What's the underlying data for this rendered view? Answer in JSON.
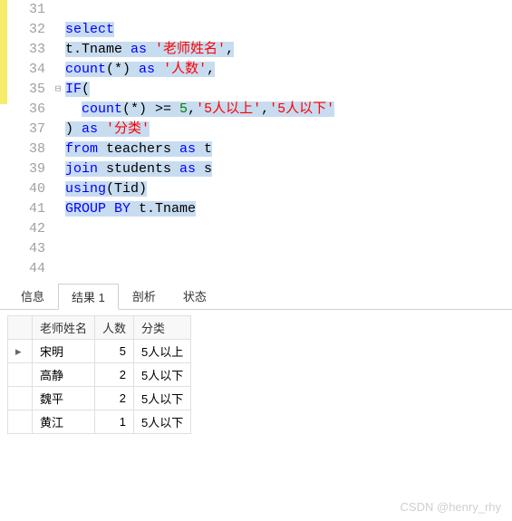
{
  "editor": {
    "lines": [
      {
        "num": "31",
        "fold": "",
        "tokens": []
      },
      {
        "num": "32",
        "fold": "",
        "tokens": [
          {
            "t": "select",
            "c": "kw-blue",
            "s": true
          }
        ]
      },
      {
        "num": "33",
        "fold": "",
        "tokens": [
          {
            "t": "t.Tname ",
            "c": "plain",
            "s": true
          },
          {
            "t": "as",
            "c": "kw-blue",
            "s": true
          },
          {
            "t": " ",
            "c": "plain",
            "s": true
          },
          {
            "t": "'老师姓名'",
            "c": "str-red",
            "s": true
          },
          {
            "t": ",",
            "c": "plain",
            "s": true
          }
        ]
      },
      {
        "num": "34",
        "fold": "",
        "tokens": [
          {
            "t": "count",
            "c": "kw-blue",
            "s": true
          },
          {
            "t": "(*) ",
            "c": "plain",
            "s": true
          },
          {
            "t": "as",
            "c": "kw-blue",
            "s": true
          },
          {
            "t": " ",
            "c": "plain",
            "s": true
          },
          {
            "t": "'人数'",
            "c": "str-red",
            "s": true
          },
          {
            "t": ",",
            "c": "plain",
            "s": true
          }
        ]
      },
      {
        "num": "35",
        "fold": "⊟",
        "tokens": [
          {
            "t": "IF",
            "c": "kw-blue",
            "s": true
          },
          {
            "t": "(",
            "c": "plain",
            "s": true
          }
        ]
      },
      {
        "num": "36",
        "fold": "",
        "tokens": [
          {
            "t": "  ",
            "c": "plain",
            "s": false
          },
          {
            "t": "count",
            "c": "kw-blue",
            "s": true
          },
          {
            "t": "(*) >= ",
            "c": "plain",
            "s": true
          },
          {
            "t": "5",
            "c": "num-green",
            "s": true
          },
          {
            "t": ",",
            "c": "plain",
            "s": true
          },
          {
            "t": "'5人以上'",
            "c": "str-red",
            "s": true
          },
          {
            "t": ",",
            "c": "plain",
            "s": true
          },
          {
            "t": "'5人以下'",
            "c": "str-red",
            "s": true
          }
        ]
      },
      {
        "num": "37",
        "fold": "",
        "tokens": [
          {
            "t": ") ",
            "c": "plain",
            "s": true
          },
          {
            "t": "as",
            "c": "kw-blue",
            "s": true
          },
          {
            "t": " ",
            "c": "plain",
            "s": true
          },
          {
            "t": "'分类'",
            "c": "str-red",
            "s": true
          }
        ]
      },
      {
        "num": "38",
        "fold": "",
        "tokens": [
          {
            "t": "from",
            "c": "kw-blue",
            "s": true
          },
          {
            "t": " teachers ",
            "c": "plain",
            "s": true
          },
          {
            "t": "as",
            "c": "kw-blue",
            "s": true
          },
          {
            "t": " t",
            "c": "plain",
            "s": true
          }
        ]
      },
      {
        "num": "39",
        "fold": "",
        "tokens": [
          {
            "t": "join",
            "c": "kw-blue",
            "s": true
          },
          {
            "t": " students ",
            "c": "plain",
            "s": true
          },
          {
            "t": "as",
            "c": "kw-blue",
            "s": true
          },
          {
            "t": " s",
            "c": "plain",
            "s": true
          }
        ]
      },
      {
        "num": "40",
        "fold": "",
        "tokens": [
          {
            "t": "using",
            "c": "kw-blue",
            "s": true
          },
          {
            "t": "(Tid)",
            "c": "plain",
            "s": true
          }
        ]
      },
      {
        "num": "41",
        "fold": "",
        "tokens": [
          {
            "t": "GROUP BY",
            "c": "kw-blue",
            "s": true
          },
          {
            "t": " t.Tname",
            "c": "plain",
            "s": true
          }
        ]
      },
      {
        "num": "42",
        "fold": "",
        "tokens": []
      },
      {
        "num": "43",
        "fold": "",
        "tokens": []
      },
      {
        "num": "44",
        "fold": "",
        "tokens": []
      }
    ]
  },
  "tabs": {
    "items": [
      {
        "label": "信息",
        "active": false
      },
      {
        "label": "结果 1",
        "active": true
      },
      {
        "label": "剖析",
        "active": false
      },
      {
        "label": "状态",
        "active": false
      }
    ]
  },
  "results": {
    "columns": [
      "老师姓名",
      "人数",
      "分类"
    ],
    "rows": [
      {
        "indicator": "▸",
        "cells": [
          "宋明",
          "5",
          "5人以上"
        ]
      },
      {
        "indicator": "",
        "cells": [
          "高静",
          "2",
          "5人以下"
        ]
      },
      {
        "indicator": "",
        "cells": [
          "魏平",
          "2",
          "5人以下"
        ]
      },
      {
        "indicator": "",
        "cells": [
          "黄江",
          "1",
          "5人以下"
        ]
      }
    ]
  },
  "watermark": "CSDN @henry_rhy"
}
